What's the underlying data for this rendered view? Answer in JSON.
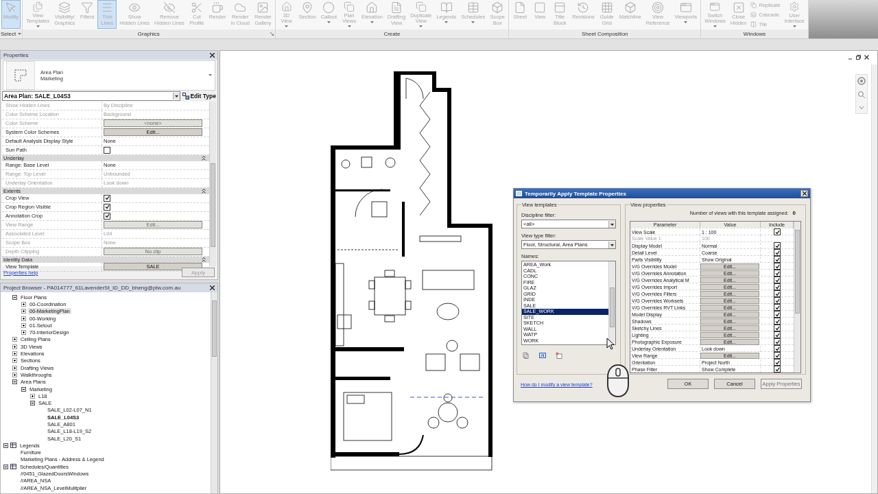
{
  "ribbon": {
    "groups": [
      {
        "label": "Select",
        "dropdown": true,
        "launcher": false,
        "tools": [
          {
            "kind": "large",
            "label": "Modify",
            "dropdown": false,
            "selected": true
          }
        ]
      },
      {
        "label": "Graphics",
        "dropdown": false,
        "launcher": true,
        "tools": [
          {
            "kind": "large",
            "label": "View\nTemplates",
            "dropdown": true,
            "selected": false
          },
          {
            "kind": "large",
            "label": "Visibility/\nGraphics",
            "dropdown": false,
            "selected": false
          },
          {
            "kind": "large",
            "label": "Filters",
            "dropdown": false,
            "selected": false
          },
          {
            "kind": "large",
            "label": "Thin\nLines",
            "dropdown": false,
            "selected": true
          },
          {
            "kind": "large",
            "label": "Show\nHidden Lines",
            "dropdown": false,
            "selected": false
          },
          {
            "kind": "large",
            "label": "Remove\nHidden Lines",
            "dropdown": false,
            "selected": false
          },
          {
            "kind": "large",
            "label": "Cut\nProfile",
            "dropdown": false,
            "selected": false
          },
          {
            "kind": "large",
            "label": "Render",
            "dropdown": false,
            "selected": false
          },
          {
            "kind": "large",
            "label": "Render\nin Cloud",
            "dropdown": false,
            "selected": false
          },
          {
            "kind": "large",
            "label": "Render\nGallery",
            "dropdown": false,
            "selected": false
          }
        ]
      },
      {
        "label": "Create",
        "dropdown": false,
        "launcher": false,
        "tools": [
          {
            "kind": "large",
            "label": "3D\nView",
            "dropdown": true,
            "selected": false
          },
          {
            "kind": "large",
            "label": "Section",
            "dropdown": false,
            "selected": false
          },
          {
            "kind": "large",
            "label": "Callout",
            "dropdown": true,
            "selected": false
          },
          {
            "kind": "large",
            "label": "Plan\nViews",
            "dropdown": true,
            "selected": false
          },
          {
            "kind": "large",
            "label": "Elevation",
            "dropdown": true,
            "selected": false
          },
          {
            "kind": "large",
            "label": "Drafting\nView",
            "dropdown": false,
            "selected": false
          },
          {
            "kind": "large",
            "label": "Duplicate\nView",
            "dropdown": true,
            "selected": false
          },
          {
            "kind": "large",
            "label": "Legends",
            "dropdown": true,
            "selected": false
          },
          {
            "kind": "large",
            "label": "Schedules",
            "dropdown": true,
            "selected": false
          },
          {
            "kind": "large",
            "label": "Scope\nBox",
            "dropdown": false,
            "selected": false
          }
        ]
      },
      {
        "label": "Sheet Composition",
        "dropdown": false,
        "launcher": false,
        "tools": [
          {
            "kind": "large",
            "label": "Sheet",
            "dropdown": false,
            "selected": false
          },
          {
            "kind": "large",
            "label": "View",
            "dropdown": false,
            "selected": false
          },
          {
            "kind": "large",
            "label": "Title\nBlock",
            "dropdown": false,
            "selected": false
          },
          {
            "kind": "large",
            "label": "Revisions",
            "dropdown": false,
            "selected": false
          },
          {
            "kind": "large",
            "label": "Guide\nGrid",
            "dropdown": false,
            "selected": false
          },
          {
            "kind": "large",
            "label": "Matchline",
            "dropdown": false,
            "selected": false
          },
          {
            "kind": "large",
            "label": "View\nReference",
            "dropdown": false,
            "selected": false
          },
          {
            "kind": "large",
            "label": "Viewports",
            "dropdown": true,
            "selected": false
          }
        ]
      },
      {
        "label": "Windows",
        "dropdown": false,
        "launcher": false,
        "tools": [
          {
            "kind": "large",
            "label": "Switch\nWindows",
            "dropdown": true,
            "selected": false
          },
          {
            "kind": "large",
            "label": "Close\nHidden",
            "dropdown": false,
            "selected": false
          },
          {
            "kind": "small",
            "label": "Replicate",
            "selected": false
          },
          {
            "kind": "small",
            "label": "Cascade",
            "selected": false
          },
          {
            "kind": "small",
            "label": "Tile",
            "selected": false
          },
          {
            "kind": "large",
            "label": "User\nInterface",
            "dropdown": true,
            "selected": false
          }
        ]
      }
    ]
  },
  "properties": {
    "title": "Properties",
    "type_name": "Area Plan",
    "type_family": "Marketing",
    "instance": "Area Plan: SALE_L04S3",
    "edit_type": "Edit Type",
    "rows": [
      {
        "kind": "text",
        "name": "Show Hidden Lines",
        "value": "By Discipline",
        "disabled": true
      },
      {
        "kind": "text",
        "name": "Color Scheme Location",
        "value": "Background",
        "disabled": true
      },
      {
        "kind": "button",
        "name": "Color Scheme",
        "value": "<none>",
        "disabled": true
      },
      {
        "kind": "button",
        "name": "System Color Schemes",
        "value": "Edit...",
        "disabled": false
      },
      {
        "kind": "text",
        "name": "Default Analysis Display Style",
        "value": "None",
        "disabled": false
      },
      {
        "kind": "check",
        "name": "Sun Path",
        "checked": false,
        "disabled": false
      },
      {
        "kind": "group",
        "name": "Underlay",
        "expanded": true
      },
      {
        "kind": "text",
        "name": "Range: Base Level",
        "value": "None",
        "disabled": false
      },
      {
        "kind": "text",
        "name": "Range: Top Level",
        "value": "Unbounded",
        "disabled": true
      },
      {
        "kind": "text",
        "name": "Underlay Orientation",
        "value": "Look down",
        "disabled": true
      },
      {
        "kind": "group",
        "name": "Extents",
        "expanded": true
      },
      {
        "kind": "check",
        "name": "Crop View",
        "checked": true,
        "disabled": false
      },
      {
        "kind": "check",
        "name": "Crop Region Visible",
        "checked": true,
        "disabled": false
      },
      {
        "kind": "check",
        "name": "Annotation Crop",
        "checked": true,
        "disabled": false
      },
      {
        "kind": "button",
        "name": "View Range",
        "value": "Edit...",
        "disabled": true
      },
      {
        "kind": "text",
        "name": "Associated Level",
        "value": "L04",
        "disabled": true
      },
      {
        "kind": "text",
        "name": "Scope Box",
        "value": "None",
        "disabled": true
      },
      {
        "kind": "button",
        "name": "Depth Clipping",
        "value": "No clip",
        "disabled": true
      },
      {
        "kind": "group",
        "name": "Identity Data",
        "expanded": true
      },
      {
        "kind": "button",
        "name": "View Template",
        "value": "SALE",
        "disabled": false
      }
    ],
    "help": "Properties help",
    "apply": {
      "label": "Apply",
      "disabled": true
    }
  },
  "browser": {
    "title": "Project Browser - PA014777_61LavenderSt_ID_DD_bheng@ptw.com.au",
    "tree": {
      "continued_items": [
        {
          "label": "Floor Plans",
          "expanded": true,
          "selected": false,
          "current": false,
          "children": [
            {
              "label": "00-Coordination",
              "expanded": false,
              "selected": false,
              "current": false
            },
            {
              "label": "00-MarketingPlan",
              "expanded": false,
              "selected": true,
              "current": false
            },
            {
              "label": "00-Working",
              "expanded": false,
              "selected": false,
              "current": false
            },
            {
              "label": "01-Setout",
              "expanded": false,
              "selected": false,
              "current": false
            },
            {
              "label": "70-InteriorDesign",
              "expanded": false,
              "selected": false,
              "current": false
            }
          ]
        },
        {
          "label": "Ceiling Plans",
          "expanded": false,
          "selected": false,
          "current": false
        },
        {
          "label": "3D Views",
          "expanded": false,
          "selected": false,
          "current": false
        },
        {
          "label": "Elevations",
          "expanded": false,
          "selected": false,
          "current": false
        },
        {
          "label": "Sections",
          "expanded": false,
          "selected": false,
          "current": false
        },
        {
          "label": "Drafting Views",
          "expanded": false,
          "selected": false,
          "current": false
        },
        {
          "label": "Walkthroughs",
          "expanded": false,
          "selected": false,
          "current": false
        },
        {
          "label": "Area Plans",
          "expanded": true,
          "selected": false,
          "current": false,
          "children": [
            {
              "label": "Marketing",
              "expanded": true,
              "selected": false,
              "current": false,
              "children": [
                {
                  "label": "L18",
                  "expanded": false,
                  "selected": false,
                  "current": false
                },
                {
                  "label": "SALE",
                  "expanded": true,
                  "selected": false,
                  "current": false,
                  "children": [
                    {
                      "label": "SALE_L02-L07_N1",
                      "selected": false,
                      "current": false
                    },
                    {
                      "label": "SALE_L04S3",
                      "selected": false,
                      "current": true
                    },
                    {
                      "label": "SALE_A801",
                      "selected": false,
                      "current": false
                    },
                    {
                      "label": "SALE_L18-L19_S2",
                      "selected": false,
                      "current": false
                    },
                    {
                      "label": "SALE_L20_S1",
                      "selected": false,
                      "current": false
                    }
                  ]
                }
              ]
            }
          ]
        }
      ],
      "root_items": [
        {
          "label": "Legends",
          "expanded": true,
          "selected": false,
          "current": false,
          "children": [
            {
              "label": "Furniture",
              "selected": false,
              "current": false
            },
            {
              "label": "Marketing Plans - Address & Legend",
              "selected": false,
              "current": false
            }
          ]
        },
        {
          "label": "Schedules/Quantities",
          "expanded": true,
          "selected": false,
          "current": false,
          "children": [
            {
              "label": "//0451_GlazedDoorsWindows",
              "selected": false,
              "current": false
            },
            {
              "label": "//AREA_NSA",
              "selected": false,
              "current": false
            },
            {
              "label": "//AREA_NSA_LevelMulitplier",
              "selected": false,
              "current": false
            }
          ]
        }
      ]
    }
  },
  "dialog": {
    "title": "Temporarily Apply Template Properties",
    "templates": {
      "title": "View templates",
      "discipline_label": "Discipline filter:",
      "discipline": "<all>",
      "type_label": "View type filter:",
      "type": "Floor, Structural, Area Plans",
      "names_label": "Names:",
      "names": [
        {
          "label": "AREA_Work",
          "selected": false
        },
        {
          "label": "CADL",
          "selected": false
        },
        {
          "label": "CONC",
          "selected": false
        },
        {
          "label": "FIRE",
          "selected": false
        },
        {
          "label": "GLAZ",
          "selected": false
        },
        {
          "label": "GRID",
          "selected": false
        },
        {
          "label": "INDE",
          "selected": false
        },
        {
          "label": "SALE",
          "selected": false
        },
        {
          "label": "SALE_WORK",
          "selected": true
        },
        {
          "label": "SITE",
          "selected": false
        },
        {
          "label": "SKETCH",
          "selected": false
        },
        {
          "label": "WALL",
          "selected": false
        },
        {
          "label": "WATP",
          "selected": false
        },
        {
          "label": "WORK",
          "selected": false
        }
      ]
    },
    "help_link": "How do I modify a view template?",
    "view_properties": {
      "title": "View properties",
      "count_label": "Number of views with this template assigned:",
      "count": "0",
      "columns": [
        "Parameter",
        "Value",
        "Include"
      ],
      "rows": [
        {
          "name": "View Scale",
          "kind": "text",
          "value": "1 : 100",
          "disabled": false,
          "include": true
        },
        {
          "name": "Scale Value    1:",
          "kind": "text",
          "value": "100",
          "disabled": true
        },
        {
          "name": "Display Model",
          "kind": "text",
          "value": "Normal",
          "disabled": false,
          "include": true
        },
        {
          "name": "Detail Level",
          "kind": "text",
          "value": "Coarse",
          "disabled": false,
          "include": true
        },
        {
          "name": "Parts Visibility",
          "kind": "text",
          "value": "Show Original",
          "disabled": false,
          "include": true
        },
        {
          "name": "V/G Overrides Model",
          "kind": "button",
          "value": "Edit...",
          "disabled": false,
          "include": true
        },
        {
          "name": "V/G Overrides Annotation",
          "kind": "button",
          "value": "Edit...",
          "disabled": false,
          "include": true
        },
        {
          "name": "V/G Overrides Analytical M",
          "kind": "button",
          "value": "Edit...",
          "disabled": false,
          "include": true
        },
        {
          "name": "V/G Overrides Import",
          "kind": "button",
          "value": "Edit...",
          "disabled": false,
          "include": true
        },
        {
          "name": "V/G Overrides Filters",
          "kind": "button",
          "value": "Edit...",
          "disabled": false,
          "include": true
        },
        {
          "name": "V/G Overrides Worksets",
          "kind": "button",
          "value": "Edit...",
          "disabled": false,
          "include": true
        },
        {
          "name": "V/G Overrides RVT Links",
          "kind": "button",
          "value": "Edit...",
          "disabled": false,
          "include": true
        },
        {
          "name": "Model Display",
          "kind": "button",
          "value": "Edit...",
          "disabled": false,
          "include": true
        },
        {
          "name": "Shadows",
          "kind": "button",
          "value": "Edit...",
          "disabled": false,
          "include": true
        },
        {
          "name": "Sketchy Lines",
          "kind": "button",
          "value": "Edit...",
          "disabled": false,
          "include": true
        },
        {
          "name": "Lighting",
          "kind": "button",
          "value": "Edit...",
          "disabled": false,
          "include": true
        },
        {
          "name": "Photographic Exposure",
          "kind": "button",
          "value": "Edit...",
          "disabled": false,
          "include": true
        },
        {
          "name": "Underlay Orientation",
          "kind": "text",
          "value": "Look down",
          "disabled": false,
          "include": true
        },
        {
          "name": "View Range",
          "kind": "button",
          "value": "Edit...",
          "disabled": false,
          "include": true
        },
        {
          "name": "Orientation",
          "kind": "text",
          "value": "Project North",
          "disabled": false,
          "include": true
        },
        {
          "name": "Phase Filter",
          "kind": "text",
          "value": "Show Complete",
          "disabled": false,
          "include": true
        }
      ]
    },
    "buttons": [
      {
        "label": "OK",
        "disabled": false
      },
      {
        "label": "Cancel",
        "disabled": false
      },
      {
        "label": "Apply Properties",
        "disabled": true
      }
    ]
  }
}
